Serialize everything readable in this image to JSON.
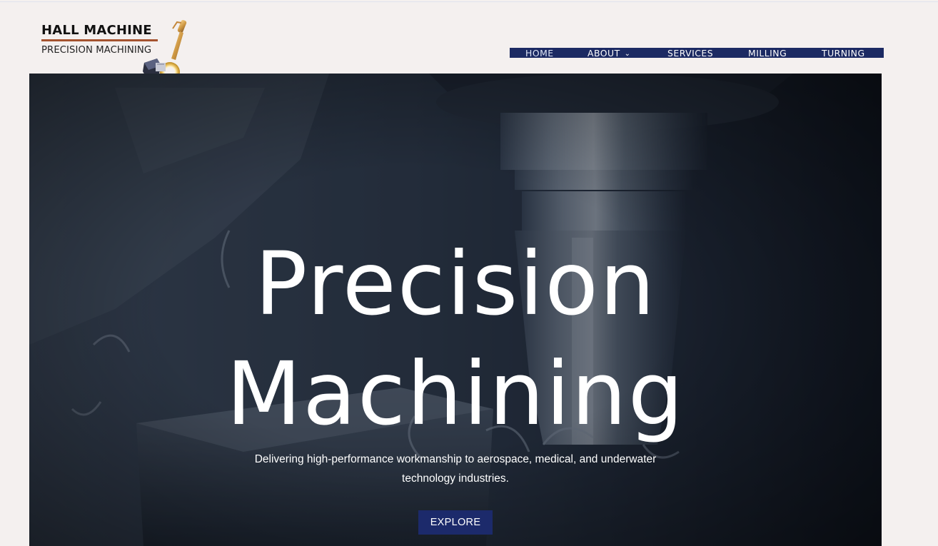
{
  "brand": {
    "line1": "HALL MACHINE",
    "line2": "PRECISION MACHINING",
    "rule_color": "#a5532f"
  },
  "nav": {
    "bar_color": "#1c2a63",
    "items": [
      {
        "label": "HOME",
        "active": true
      },
      {
        "label": "ABOUT",
        "has_dropdown": true,
        "icon": "chevron-down-icon"
      },
      {
        "label": "SERVICES"
      },
      {
        "label": "MILLING"
      },
      {
        "label": "TURNING"
      }
    ]
  },
  "hero": {
    "title_line1": "Precision",
    "title_line2": "Machining",
    "subtitle_line1": "Delivering high-performance workmanship to aerospace, medical, and underwater",
    "subtitle_line2": "technology industries.",
    "button_label": "EXPLORE",
    "button_color": "#1c2a6b"
  }
}
